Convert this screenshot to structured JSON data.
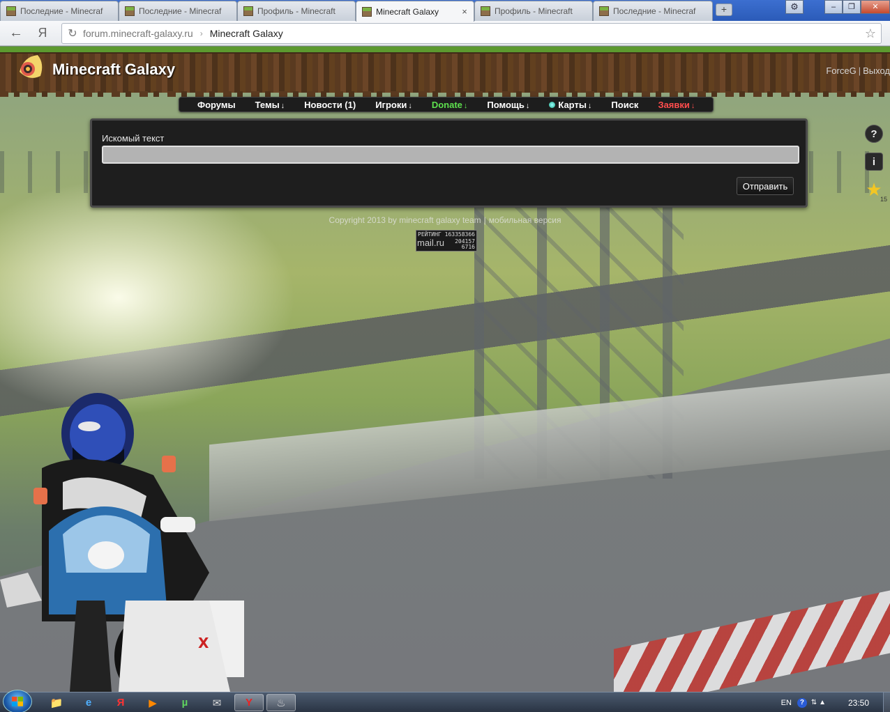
{
  "browser": {
    "tabs": [
      {
        "title": "Последние - Minecraf",
        "active": false
      },
      {
        "title": "Последние - Minecraf",
        "active": false
      },
      {
        "title": "Профиль - Minecraft",
        "active": false
      },
      {
        "title": "Minecraft Galaxy",
        "active": true,
        "close": "×"
      },
      {
        "title": "Профиль - Minecraft",
        "active": false
      },
      {
        "title": "Последние - Minecraf",
        "active": false
      }
    ],
    "new_tab_label": "+",
    "back_icon": "←",
    "yandex_icon": "Я",
    "reload_icon": "↻",
    "url_host": "forum.minecraft-galaxy.ru",
    "url_separator": "›",
    "url_title": "Minecraft Galaxy",
    "bookmark_icon": "☆",
    "settings_icon": "⚙",
    "window_buttons": {
      "minimize": "–",
      "maximize": "❐",
      "close": "✕"
    }
  },
  "site": {
    "logo_text": "Minecraft Galaxy",
    "user_links": {
      "username": "ForceG",
      "separator": "|",
      "logout": "Выход"
    },
    "nav": [
      {
        "label": "Форумы",
        "arrow": ""
      },
      {
        "label": "Темы",
        "arrow": "↓"
      },
      {
        "label": "Новости (1)",
        "arrow": ""
      },
      {
        "label": "Игроки",
        "arrow": "↓"
      },
      {
        "label": "Donate",
        "arrow": "↓"
      },
      {
        "label": "Помощь",
        "arrow": "↓"
      },
      {
        "label": "Карты",
        "arrow": "↓"
      },
      {
        "label": "Поиск",
        "arrow": ""
      },
      {
        "label": "Заявки",
        "arrow": "↓"
      }
    ],
    "search": {
      "label": "Искомый текст",
      "value": "",
      "submit_label": "Отправить"
    },
    "footer": {
      "copyright": "Copyright 2013 by minecraft galaxy team",
      "separator": "|",
      "mobile_link": "мобильная версия"
    },
    "counter": {
      "rating_label": "РЕЙТИНГ",
      "rating_id": "163358366",
      "brand": "mail.ru",
      "stat1": "204157",
      "stat2": "6716"
    },
    "side_icons": {
      "help": "?",
      "info": "i",
      "star": "★",
      "star_count": "15"
    },
    "colors": {
      "donate": "#5ee04e",
      "apps": "#ff4d4d"
    }
  },
  "taskbar": {
    "apps": [
      {
        "icon": "📁"
      },
      {
        "icon": "e"
      },
      {
        "icon": "Я"
      },
      {
        "icon": "▶"
      },
      {
        "icon": "µ"
      },
      {
        "icon": "✉"
      },
      {
        "icon": "Y"
      },
      {
        "icon": "♨"
      }
    ],
    "language": "EN",
    "help_icon": "?",
    "tray_icons": "⇅ ▲",
    "clock": "23:50"
  }
}
